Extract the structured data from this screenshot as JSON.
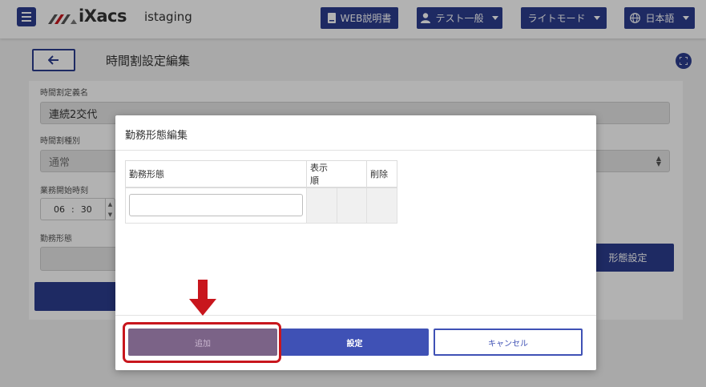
{
  "header": {
    "logo_text": "iXacs",
    "env_name": "istaging",
    "manual_label": "WEB説明書",
    "user_label": "テスト一般",
    "theme_label": "ライトモード",
    "language_label": "日本語"
  },
  "page": {
    "title": "時間割設定編集",
    "name_label": "時間割定義名",
    "name_value": "連続2交代",
    "kind_label": "時間割種別",
    "kind_value": "通常",
    "start_label": "業務開始時刻",
    "start_hour": "06",
    "start_minute": "30",
    "start_separator": ":",
    "work_type_label": "勤務形態",
    "work_type_setting_button": "形態設定"
  },
  "modal": {
    "title": "勤務形態編集",
    "columns": [
      "勤務形態",
      "表示順",
      "削除"
    ],
    "input_value": "",
    "add_button": "追加",
    "set_button": "設定",
    "cancel_button": "キャンセル"
  },
  "colors": {
    "primary": "#2c3d8f",
    "modal_primary": "#3f51b5",
    "highlight": "#c8161d",
    "disabled_add": "#7b6387"
  },
  "icons": [
    "menu-icon",
    "book-icon",
    "user-icon",
    "globe-icon",
    "arrow-left-icon",
    "expand-icon",
    "arrow-down-icon"
  ]
}
